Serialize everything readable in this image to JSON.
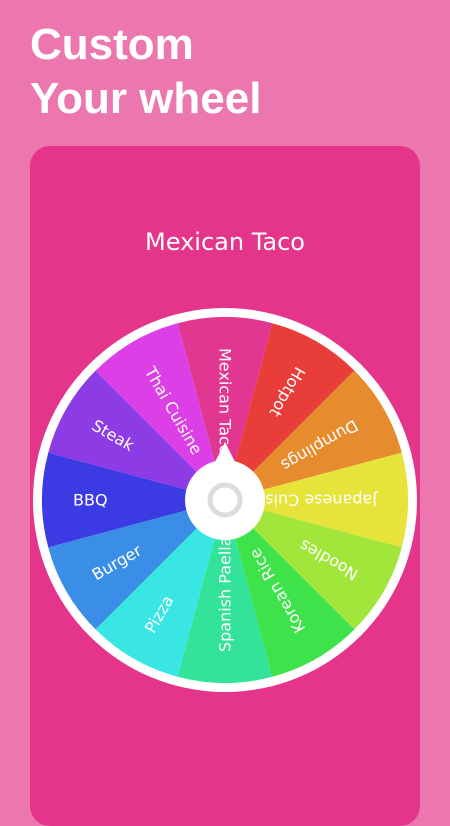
{
  "headline": {
    "line1": "Custom",
    "line2": "Your wheel"
  },
  "wheel": {
    "result": "Mexican Taco",
    "segments": [
      {
        "label": "Mexican Taco",
        "color": "#e13791"
      },
      {
        "label": "Hotpot",
        "color": "#e93d3a"
      },
      {
        "label": "Dumplings",
        "color": "#e68b2e"
      },
      {
        "label": "Japanese Cuisine",
        "color": "#e6e43a"
      },
      {
        "label": "Noodles",
        "color": "#a3e63b"
      },
      {
        "label": "Korean Rice",
        "color": "#3ee24a"
      },
      {
        "label": "Spanish Paella",
        "color": "#33e39a"
      },
      {
        "label": "Pizza",
        "color": "#39e6e3"
      },
      {
        "label": "Burger",
        "color": "#3a8ee6"
      },
      {
        "label": "BBQ",
        "color": "#3c3be3"
      },
      {
        "label": "Steak",
        "color": "#8c3be5"
      },
      {
        "label": "Thai Cuisine",
        "color": "#dc3fe6"
      }
    ]
  },
  "colors": {
    "background": "#ec77ae",
    "card": "#e5358a",
    "rim": "#ffffff"
  }
}
